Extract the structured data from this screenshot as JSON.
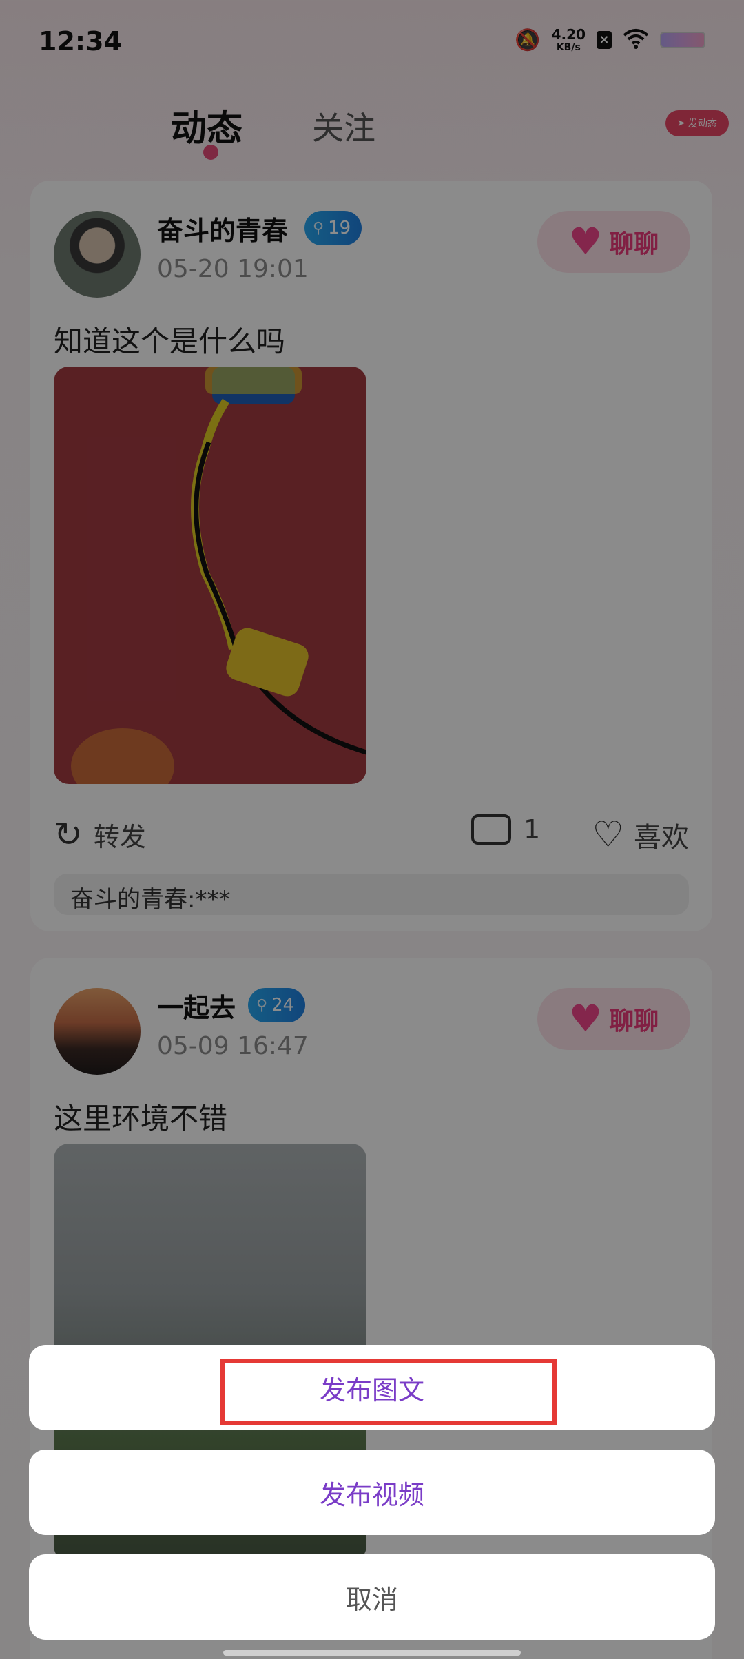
{
  "status_bar": {
    "time": "12:34",
    "net_speed_value": "4.20",
    "net_speed_unit": "KB/s"
  },
  "header": {
    "tabs": [
      {
        "label": "动态"
      },
      {
        "label": "关注"
      }
    ],
    "post_button_label": "发动态"
  },
  "posts": [
    {
      "username": "奋斗的青春",
      "badge": "19",
      "time": "05-20 19:01",
      "chat_label": "聊聊",
      "text": "知道这个是什么吗",
      "repost_label": "转发",
      "comment_count": "1",
      "like_label": "喜欢",
      "comment_preview": "奋斗的青春:***"
    },
    {
      "username": "一起去",
      "badge": "24",
      "time": "05-09 16:47",
      "chat_label": "聊聊",
      "text": "这里环境不错"
    }
  ],
  "action_sheet": {
    "options": [
      {
        "label": "发布图文"
      },
      {
        "label": "发布视频"
      }
    ],
    "cancel_label": "取消"
  },
  "colors": {
    "accent": "#7a3cc7",
    "highlight": "#e53935",
    "badge": "#1f8fe8",
    "chat": "#ec3a7a"
  },
  "icons": [
    "mute-bell-icon",
    "wifi-icon",
    "battery-icon",
    "location-pin-icon",
    "heart-icon",
    "repost-icon",
    "comment-icon",
    "like-icon",
    "send-icon"
  ]
}
